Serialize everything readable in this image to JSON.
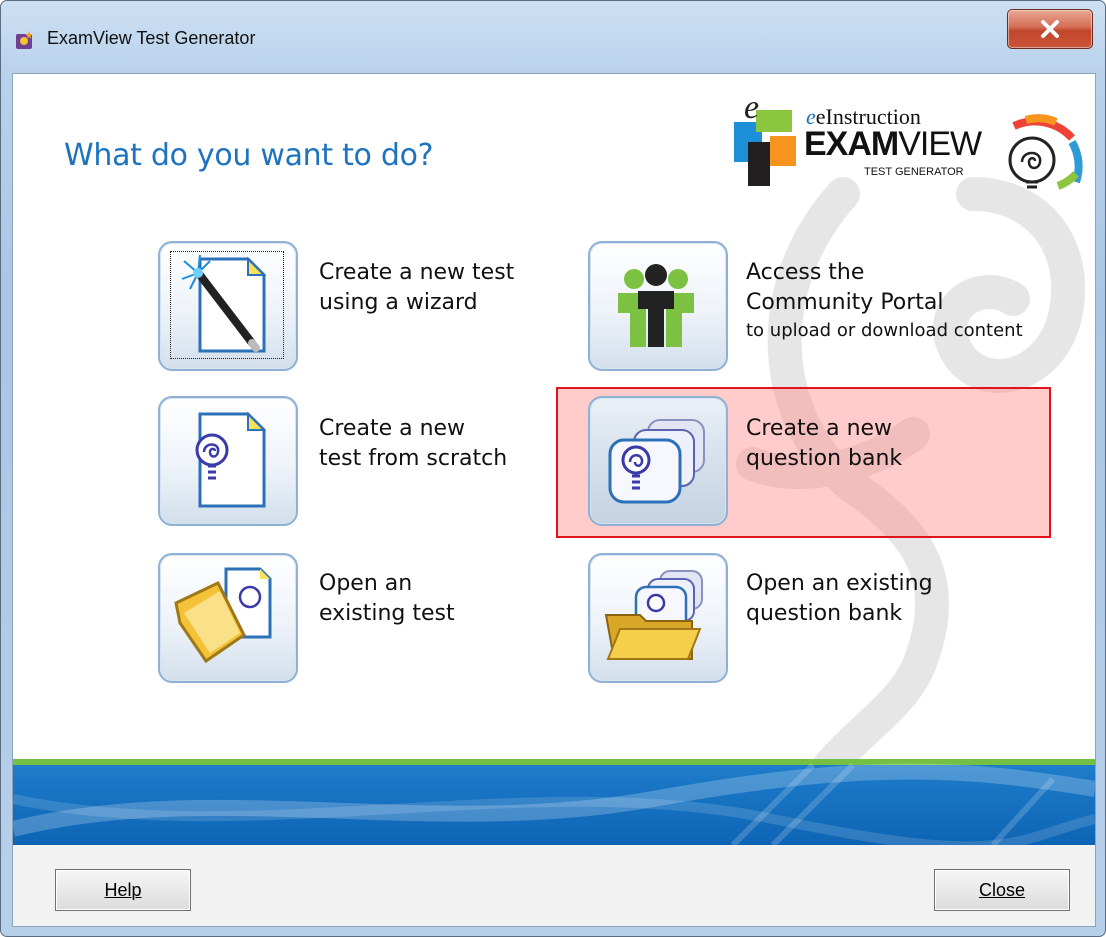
{
  "window": {
    "title": "ExamView Test Generator"
  },
  "main": {
    "heading": "What do you want to do?"
  },
  "logo": {
    "brand_small": "eInstruction",
    "brand_big_bold": "EXAM",
    "brand_big_light": "VIEW",
    "tagline": "TEST GENERATOR"
  },
  "options": [
    {
      "lines": [
        "Create a new test",
        "using a wizard"
      ]
    },
    {
      "lines": [
        "Access the",
        "Community Portal"
      ],
      "subline": "to upload or download content"
    },
    {
      "lines": [
        "Create a new",
        "test from scratch"
      ]
    },
    {
      "lines": [
        "Create a new",
        "question bank"
      ]
    },
    {
      "lines": [
        "Open an",
        "existing test"
      ]
    },
    {
      "lines": [
        "Open an existing",
        "question bank"
      ]
    }
  ],
  "buttons": {
    "help": "Help",
    "close": "Close"
  },
  "colors": {
    "heading": "#1e73be",
    "highlight_border": "#e0141c",
    "band": "#1571c3",
    "band_stripe": "#74c045"
  }
}
